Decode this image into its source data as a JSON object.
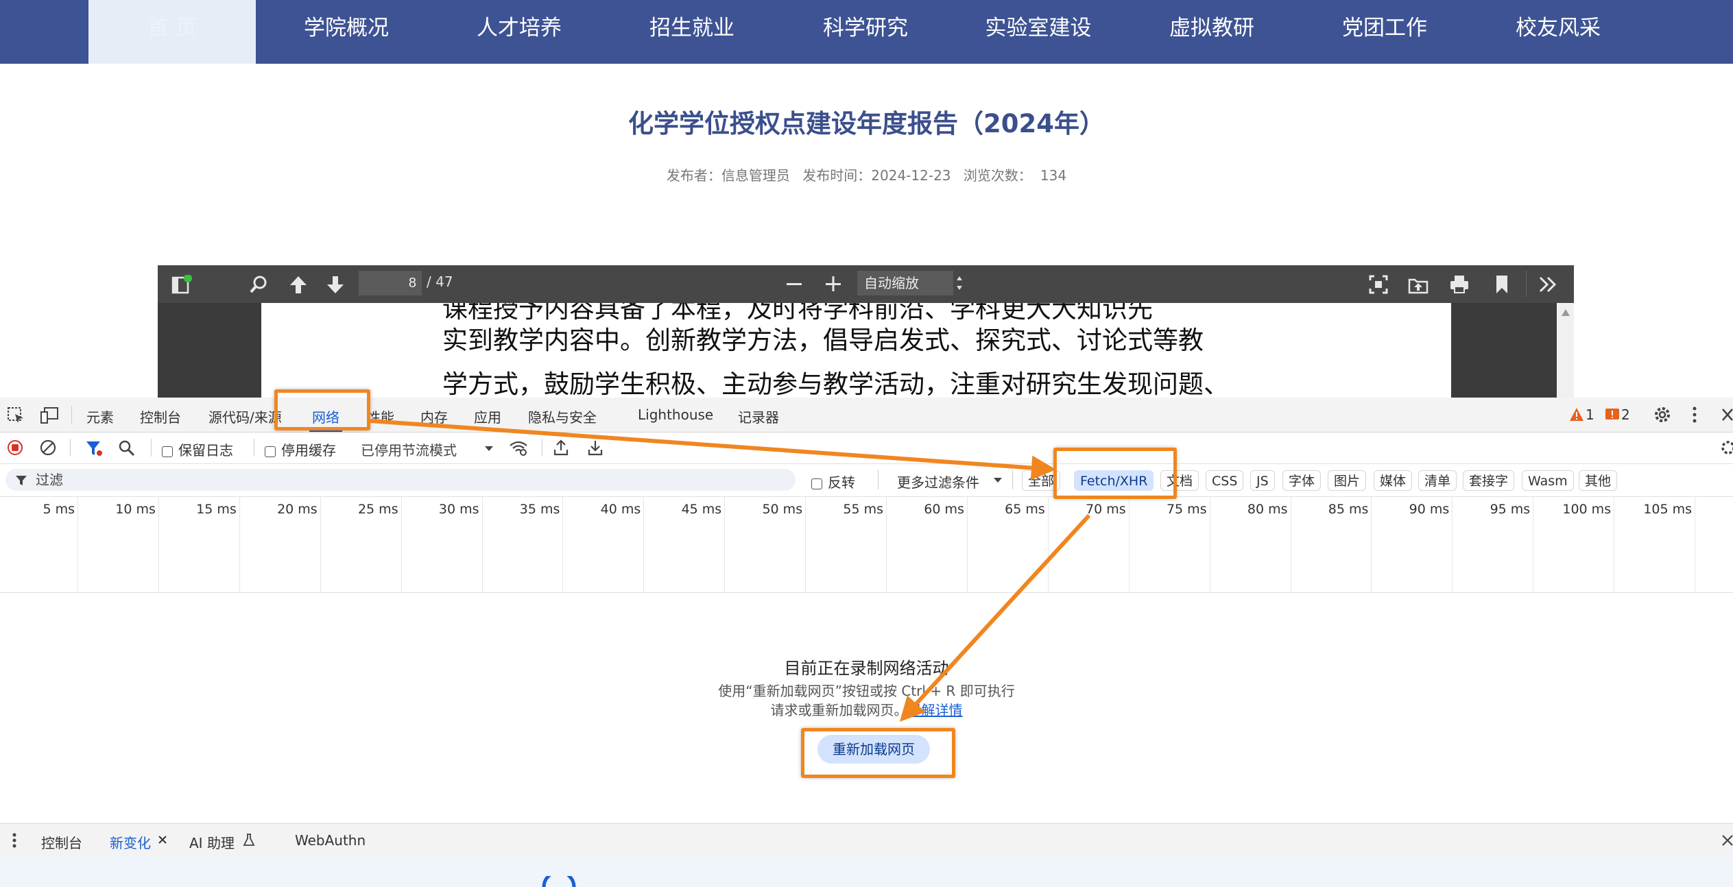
{
  "site_nav": {
    "items": [
      "首  页",
      "学院概况",
      "人才培养",
      "招生就业",
      "科学研究",
      "实验室建设",
      "虚拟教研",
      "党团工作",
      "校友风采"
    ]
  },
  "article": {
    "title": "化学学位授权点建设年度报告（2024年）",
    "publisher_label": "发布者：",
    "publisher": "信息管理员",
    "date_label": "发布时间：",
    "date": "2024-12-23",
    "views_label": "浏览次数：",
    "views": "134"
  },
  "pdf_viewer": {
    "current_page": "8",
    "total_pages": "/ 47",
    "zoom": "自动缩放",
    "text_lines": [
      "课程授予内容具备了本程，及时将学科前沿、学科更大大知识先",
      "实到教学内容中。创新教学方法，倡导启发式、探究式、讨论式等教",
      "学方式，鼓励学生积极、主动参与教学活动，注重对研究生发现问题、"
    ]
  },
  "devtools": {
    "tabs": [
      "元素",
      "控制台",
      "源代码/来源",
      "网络",
      "性能",
      "内存",
      "应用",
      "隐私与安全",
      "Lighthouse",
      "记录器"
    ],
    "active_tab": "网络",
    "warnings": "1",
    "issues": "2",
    "toolbar": {
      "preserve_log": "保留日志",
      "disable_cache": "停用缓存",
      "throttle": "已停用节流模式"
    },
    "filter": {
      "placeholder": "过滤",
      "invert": "反转",
      "more_filters": "更多过滤条件",
      "types": [
        "全部",
        "Fetch/XHR",
        "文档",
        "CSS",
        "JS",
        "字体",
        "图片",
        "媒体",
        "清单",
        "套接字",
        "Wasm",
        "其他"
      ],
      "active_type": "Fetch/XHR"
    },
    "timeline_ticks": [
      "5 ms",
      "10 ms",
      "15 ms",
      "20 ms",
      "25 ms",
      "30 ms",
      "35 ms",
      "40 ms",
      "45 ms",
      "50 ms",
      "55 ms",
      "60 ms",
      "65 ms",
      "70 ms",
      "75 ms",
      "80 ms",
      "85 ms",
      "90 ms",
      "95 ms",
      "100 ms",
      "105 ms"
    ],
    "empty_state": {
      "title": "目前正在录制网络活动",
      "line1": "使用“重新加载网页”按钮或按 Ctrl + R 即可执行",
      "line2_prefix": "请求或重新加载网页。",
      "learn_more": "了解详情",
      "reload_button": "重新加载网页"
    },
    "drawer_tabs": [
      "控制台",
      "新变化",
      "AI 助理",
      "WebAuthn"
    ],
    "drawer_active": "新变化"
  },
  "colors": {
    "nav_bg": "#3e5393",
    "title": "#3b4f8c",
    "accent_blue": "#1a5fd3",
    "chip_active": "#d3e3fd",
    "highlight_orange": "#f0861f"
  }
}
